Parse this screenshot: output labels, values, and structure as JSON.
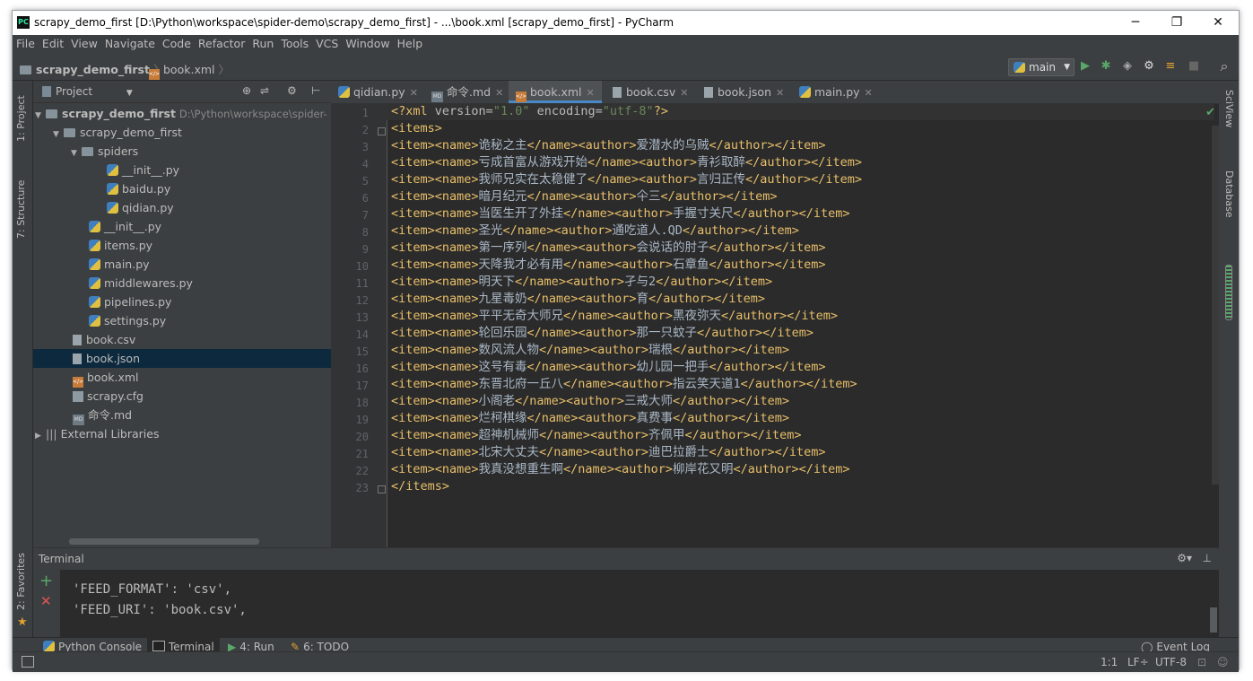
{
  "window": {
    "title": "scrapy_demo_first [D:\\Python\\workspace\\spider-demo\\scrapy_demo_first] - ...\\book.xml [scrapy_demo_first] - PyCharm",
    "icon": "pycharm-icon",
    "minimize_glyph": "─",
    "restore_glyph": "❐",
    "close_glyph": "✕"
  },
  "menu": [
    "File",
    "Edit",
    "View",
    "Navigate",
    "Code",
    "Refactor",
    "Run",
    "Tools",
    "VCS",
    "Window",
    "Help"
  ],
  "breadcrumb": {
    "project": "scrapy_demo_first",
    "file": "book.xml"
  },
  "toolbar": {
    "run_config": "main",
    "run_icon": "▶",
    "debug_icon": "✱",
    "coverage_icon": "◈",
    "profile_icon": "⚙",
    "build_icon": "≡",
    "stop_icon": "■",
    "search_icon": "⌕"
  },
  "sidebars": {
    "left_top": "1: Project",
    "left_mid": "7: Structure",
    "left_bottom": "2: Favorites",
    "right_top": "SciView",
    "right_mid": "Database"
  },
  "project_panel": {
    "title": "Project",
    "tree": [
      {
        "label": "scrapy_demo_first",
        "path": "D:\\Python\\workspace\\spider-",
        "icon": "folder-icon",
        "depth": 0,
        "expanded": true,
        "bold": true
      },
      {
        "label": "scrapy_demo_first",
        "icon": "folder-icon",
        "depth": 1,
        "expanded": true
      },
      {
        "label": "spiders",
        "icon": "folder-icon",
        "depth": 2,
        "expanded": true
      },
      {
        "label": "__init__.py",
        "icon": "python-file-icon",
        "depth": 3
      },
      {
        "label": "baidu.py",
        "icon": "python-file-icon",
        "depth": 3
      },
      {
        "label": "qidian.py",
        "icon": "python-file-icon",
        "depth": 3
      },
      {
        "label": "__init__.py",
        "icon": "python-file-icon",
        "depth": 2
      },
      {
        "label": "items.py",
        "icon": "python-file-icon",
        "depth": 2
      },
      {
        "label": "main.py",
        "icon": "python-file-icon",
        "depth": 2
      },
      {
        "label": "middlewares.py",
        "icon": "python-file-icon",
        "depth": 2
      },
      {
        "label": "pipelines.py",
        "icon": "python-file-icon",
        "depth": 2
      },
      {
        "label": "settings.py",
        "icon": "python-file-icon",
        "depth": 2
      },
      {
        "label": "book.csv",
        "icon": "text-file-icon",
        "depth": 1
      },
      {
        "label": "book.json",
        "icon": "text-file-icon",
        "depth": 1,
        "selected": true
      },
      {
        "label": "book.xml",
        "icon": "xml-file-icon",
        "depth": 1
      },
      {
        "label": "scrapy.cfg",
        "icon": "config-file-icon",
        "depth": 1
      },
      {
        "label": "命令.md",
        "icon": "markdown-file-icon",
        "depth": 1
      },
      {
        "label": "External Libraries",
        "icon": "library-icon",
        "depth": 0,
        "expanded": false
      }
    ]
  },
  "editor_tabs": [
    {
      "label": "qidian.py",
      "icon": "python-file-icon"
    },
    {
      "label": "命令.md",
      "icon": "markdown-file-icon"
    },
    {
      "label": "book.xml",
      "icon": "xml-file-icon",
      "active": true
    },
    {
      "label": "book.csv",
      "icon": "text-file-icon"
    },
    {
      "label": "book.json",
      "icon": "text-file-icon"
    },
    {
      "label": "main.py",
      "icon": "python-file-icon"
    }
  ],
  "xml_decl": {
    "version": "1.0",
    "encoding": "utf-8"
  },
  "items": [
    {
      "name": "诡秘之主",
      "author": "爱潜水的乌贼"
    },
    {
      "name": "亏成首富从游戏开始",
      "author": "青衫取醉"
    },
    {
      "name": "我师兄实在太稳健了",
      "author": "言归正传"
    },
    {
      "name": "暗月纪元",
      "author": "仐三"
    },
    {
      "name": "当医生开了外挂",
      "author": "手握寸关尺"
    },
    {
      "name": "圣光",
      "author": "通吃道人.QD"
    },
    {
      "name": "第一序列",
      "author": "会说话的肘子"
    },
    {
      "name": "天降我才必有用",
      "author": "石章鱼"
    },
    {
      "name": "明天下",
      "author": "孑与2"
    },
    {
      "name": "九星毒奶",
      "author": "育"
    },
    {
      "name": "平平无奇大师兄",
      "author": "黑夜弥天"
    },
    {
      "name": "轮回乐园",
      "author": "那一只蚊子"
    },
    {
      "name": "数风流人物",
      "author": "瑞根"
    },
    {
      "name": "这号有毒",
      "author": "幼儿园一把手"
    },
    {
      "name": "东晋北府一丘八",
      "author": "指云笑天道1"
    },
    {
      "name": "小阁老",
      "author": "三戒大师"
    },
    {
      "name": "烂柯棋缘",
      "author": "真费事"
    },
    {
      "name": "超神机械师",
      "author": "齐佩甲"
    },
    {
      "name": "北宋大丈夫",
      "author": "迪巴拉爵士"
    },
    {
      "name": "我真没想重生啊",
      "author": "柳岸花又明"
    }
  ],
  "line_numbers": [
    "1",
    "2",
    "3",
    "4",
    "5",
    "6",
    "7",
    "8",
    "9",
    "10",
    "11",
    "12",
    "13",
    "14",
    "15",
    "16",
    "17",
    "18",
    "19",
    "20",
    "21",
    "22",
    "23"
  ],
  "terminal": {
    "title": "Terminal",
    "lines": [
      "'FEED_FORMAT': 'csv',",
      "'FEED_URI': 'book.csv',"
    ],
    "add_icon": "+",
    "close_icon": "✕"
  },
  "bottom_tools": [
    {
      "label": "Python Console",
      "icon": "python-console-icon"
    },
    {
      "label": "Terminal",
      "icon": "terminal-icon",
      "active": true
    },
    {
      "label": "4: Run",
      "icon": "run-icon"
    },
    {
      "label": "6: TODO",
      "icon": "todo-icon"
    }
  ],
  "event_log": "Event Log",
  "status": {
    "position": "1:1",
    "line_sep": "LF÷",
    "encoding": "UTF-8"
  },
  "colors": {
    "tag": "#e8bf6a",
    "attr_value": "#6a8759",
    "text": "#a9b7c6",
    "selection": "#0d293e",
    "accent": "#4a88c7"
  }
}
